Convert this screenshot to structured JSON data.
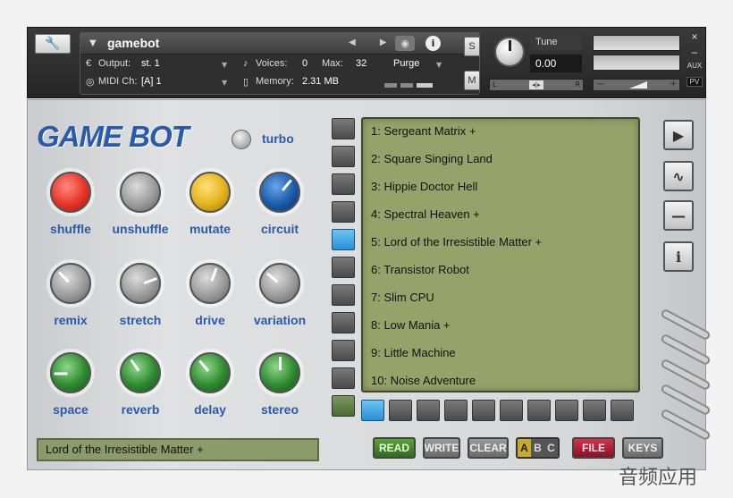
{
  "header": {
    "instrument_name": "gamebot",
    "output_label": "Output:",
    "output_value": "st. 1",
    "midi_label": "MIDI Ch:",
    "midi_value": "[A] 1",
    "voices_label": "Voices:",
    "voices_value": "0",
    "max_label": "Max:",
    "max_value": "32",
    "memory_label": "Memory:",
    "memory_value": "2.31 MB",
    "purge_label": "Purge",
    "solo_label": "S",
    "mute_label": "M",
    "tune_label": "Tune",
    "tune_value": "0.00",
    "pan_left": "L",
    "pan_right": "R",
    "pan_center": "◂|▸",
    "vol_minus": "—",
    "vol_plus": "+",
    "close_label": "×",
    "minus_label": "–",
    "aux_label": "AUX",
    "pv_label": "PV"
  },
  "logo": "GAME BOT",
  "turbo_label": "turbo",
  "knobs": [
    {
      "label": "shuffle"
    },
    {
      "label": "unshuffle"
    },
    {
      "label": "mutate"
    },
    {
      "label": "circuit"
    },
    {
      "label": "remix"
    },
    {
      "label": "stretch"
    },
    {
      "label": "drive"
    },
    {
      "label": "variation"
    },
    {
      "label": "space"
    },
    {
      "label": "reverb"
    },
    {
      "label": "delay"
    },
    {
      "label": "stereo"
    }
  ],
  "status_text": "Lord of the Irresistible Matter +",
  "presets": [
    "1: Sergeant Matrix +",
    "2: Square Singing Land",
    "3: Hippie Doctor Hell",
    "4: Spectral Heaven +",
    "5: Lord of the Irresistible Matter +",
    "6: Transistor Robot",
    "7: Slim CPU",
    "8: Low Mania +",
    "9: Little Machine",
    "10: Noise Adventure"
  ],
  "buttons": {
    "read": "READ",
    "write": "WRITE",
    "clear": "CLEAR",
    "a": "A",
    "b": "B",
    "c": "C",
    "file": "FILE",
    "keys": "KEYS"
  },
  "side_buttons": {
    "play": "▶",
    "wave": "∿",
    "minus": "—",
    "info": "i"
  },
  "watermark": "音频应用"
}
